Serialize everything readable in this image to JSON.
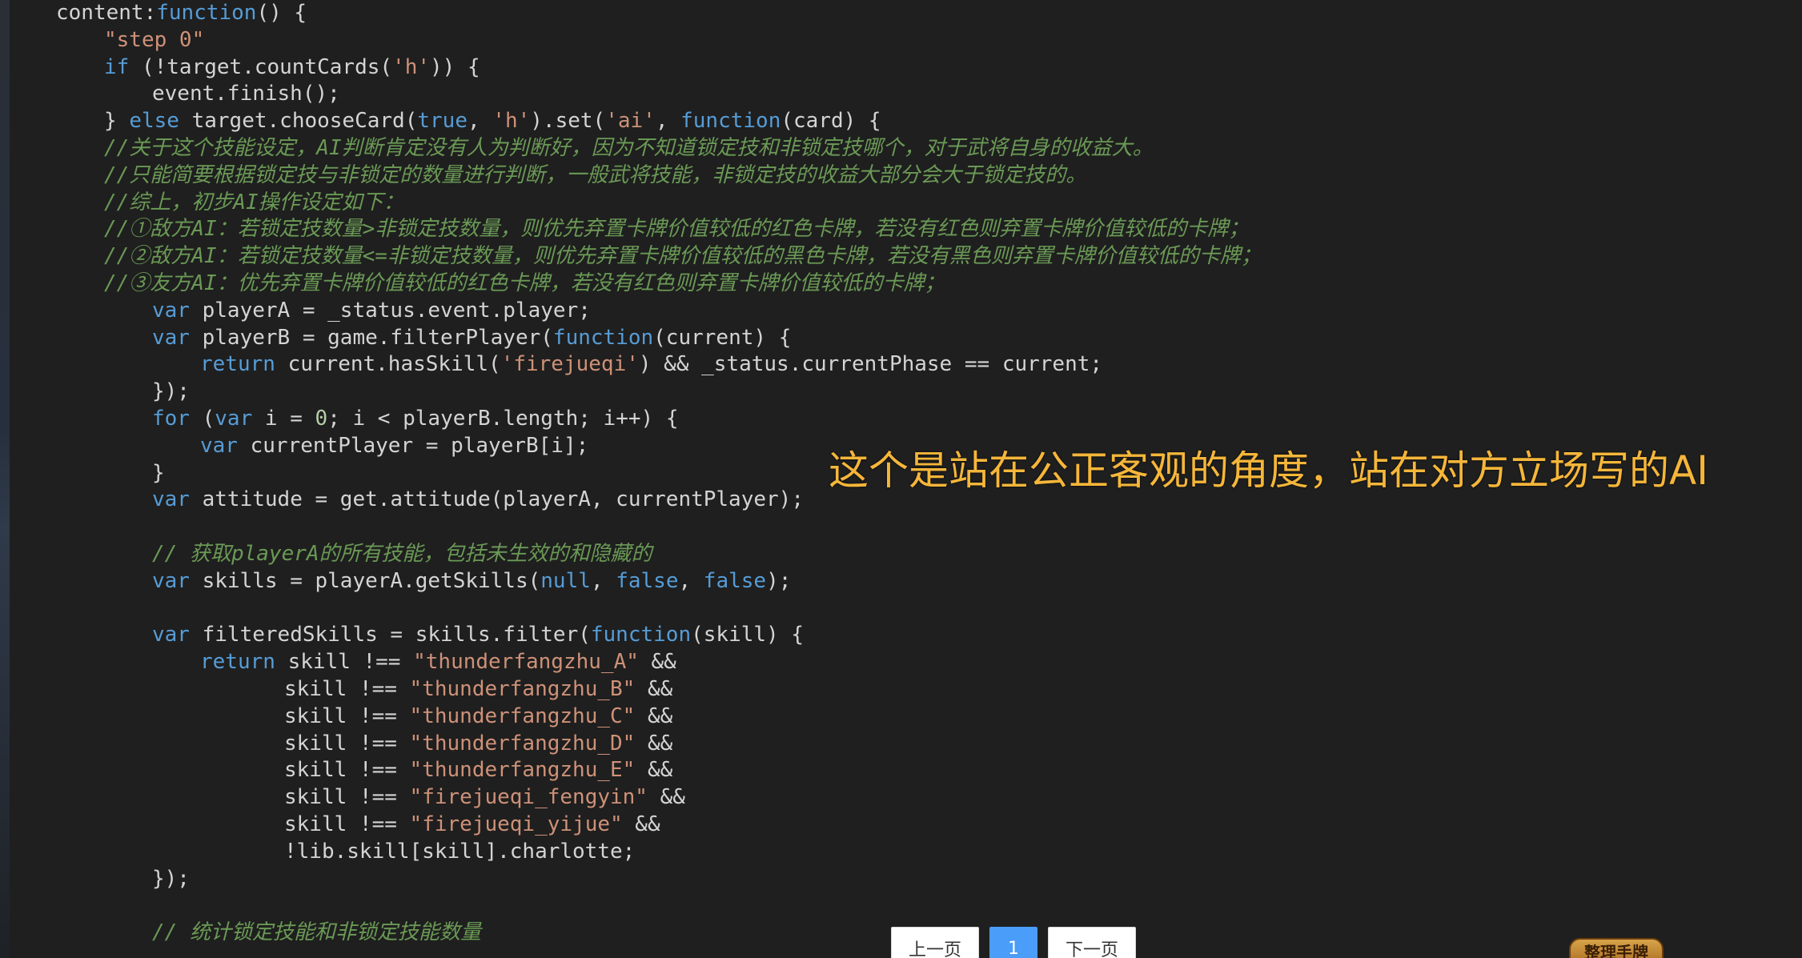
{
  "code_lines": [
    {
      "indent": 0,
      "tokens": [
        {
          "t": "content:"
        },
        {
          "t": "function",
          "c": "kw"
        },
        {
          "t": "() {"
        }
      ]
    },
    {
      "indent": 1,
      "tokens": [
        {
          "t": "\"step 0\"",
          "c": "str"
        }
      ]
    },
    {
      "indent": 1,
      "tokens": [
        {
          "t": "if",
          "c": "kw"
        },
        {
          "t": " (!target.countCards("
        },
        {
          "t": "'h'",
          "c": "str"
        },
        {
          "t": ")) {"
        }
      ]
    },
    {
      "indent": 2,
      "tokens": [
        {
          "t": "event.finish();"
        }
      ]
    },
    {
      "indent": 1,
      "tokens": [
        {
          "t": "} "
        },
        {
          "t": "else",
          "c": "kw"
        },
        {
          "t": " target.chooseCard("
        },
        {
          "t": "true",
          "c": "kw"
        },
        {
          "t": ", "
        },
        {
          "t": "'h'",
          "c": "str"
        },
        {
          "t": ").set("
        },
        {
          "t": "'ai'",
          "c": "str"
        },
        {
          "t": ", "
        },
        {
          "t": "function",
          "c": "kw"
        },
        {
          "t": "(card) {"
        }
      ]
    },
    {
      "indent": 1,
      "tokens": [
        {
          "t": "//关于这个技能设定，AI判断肯定没有人为判断好，因为不知道锁定技和非锁定技哪个，对于武将自身的收益大。",
          "c": "cm"
        }
      ]
    },
    {
      "indent": 1,
      "tokens": [
        {
          "t": "//只能简要根据锁定技与非锁定的数量进行判断，一般武将技能，非锁定技的收益大部分会大于锁定技的。",
          "c": "cm"
        }
      ]
    },
    {
      "indent": 1,
      "tokens": [
        {
          "t": "//综上，初步AI操作设定如下：",
          "c": "cm"
        }
      ]
    },
    {
      "indent": 1,
      "tokens": [
        {
          "t": "//①敌方AI：若锁定技数量>非锁定技数量，则优先弃置卡牌价值较低的红色卡牌，若没有红色则弃置卡牌价值较低的卡牌；",
          "c": "cm"
        }
      ]
    },
    {
      "indent": 1,
      "tokens": [
        {
          "t": "//②敌方AI：若锁定技数量<=非锁定技数量，则优先弃置卡牌价值较低的黑色卡牌，若没有黑色则弃置卡牌价值较低的卡牌；",
          "c": "cm"
        }
      ]
    },
    {
      "indent": 1,
      "tokens": [
        {
          "t": "//③友方AI：优先弃置卡牌价值较低的红色卡牌，若没有红色则弃置卡牌价值较低的卡牌；",
          "c": "cm"
        }
      ]
    },
    {
      "indent": 2,
      "tokens": [
        {
          "t": "var",
          "c": "kw"
        },
        {
          "t": " playerA = _status.event.player;"
        }
      ]
    },
    {
      "indent": 2,
      "tokens": [
        {
          "t": "var",
          "c": "kw"
        },
        {
          "t": " playerB = game.filterPlayer("
        },
        {
          "t": "function",
          "c": "kw"
        },
        {
          "t": "(current) {"
        }
      ]
    },
    {
      "indent": 3,
      "tokens": [
        {
          "t": "return",
          "c": "kw"
        },
        {
          "t": " current.hasSkill("
        },
        {
          "t": "'firejueqi'",
          "c": "str"
        },
        {
          "t": ") && _status.currentPhase == current;"
        }
      ]
    },
    {
      "indent": 2,
      "tokens": [
        {
          "t": "});"
        }
      ]
    },
    {
      "indent": 2,
      "tokens": [
        {
          "t": "for",
          "c": "kw"
        },
        {
          "t": " ("
        },
        {
          "t": "var",
          "c": "kw"
        },
        {
          "t": " i = "
        },
        {
          "t": "0",
          "c": "num"
        },
        {
          "t": "; i < playerB.length; i++) {"
        }
      ]
    },
    {
      "indent": 3,
      "tokens": [
        {
          "t": "var",
          "c": "kw"
        },
        {
          "t": " currentPlayer = playerB[i];"
        }
      ]
    },
    {
      "indent": 2,
      "tokens": [
        {
          "t": "}"
        }
      ]
    },
    {
      "indent": 2,
      "tokens": [
        {
          "t": "var",
          "c": "kw"
        },
        {
          "t": " attitude = get.attitude(playerA, currentPlayer);"
        }
      ]
    },
    {
      "indent": 0,
      "tokens": []
    },
    {
      "indent": 2,
      "tokens": [
        {
          "t": "// 获取playerA的所有技能，包括未生效的和隐藏的",
          "c": "cm"
        }
      ]
    },
    {
      "indent": 2,
      "tokens": [
        {
          "t": "var",
          "c": "kw"
        },
        {
          "t": " skills = playerA.getSkills("
        },
        {
          "t": "null",
          "c": "kw"
        },
        {
          "t": ", "
        },
        {
          "t": "false",
          "c": "kw"
        },
        {
          "t": ", "
        },
        {
          "t": "false",
          "c": "kw"
        },
        {
          "t": ");"
        }
      ]
    },
    {
      "indent": 0,
      "tokens": []
    },
    {
      "indent": 2,
      "tokens": [
        {
          "t": "var",
          "c": "kw"
        },
        {
          "t": " filteredSkills = skills.filter("
        },
        {
          "t": "function",
          "c": "kw"
        },
        {
          "t": "(skill) {"
        }
      ]
    },
    {
      "indent": 3,
      "tokens": [
        {
          "t": "return",
          "c": "kw"
        },
        {
          "t": " skill !== "
        },
        {
          "t": "\"thunderfangzhu_A\"",
          "c": "str"
        },
        {
          "t": " &&"
        }
      ]
    },
    {
      "indent": 4,
      "tokens": [
        {
          "t": "skill !== "
        },
        {
          "t": "\"thunderfangzhu_B\"",
          "c": "str"
        },
        {
          "t": " &&"
        }
      ]
    },
    {
      "indent": 4,
      "tokens": [
        {
          "t": "skill !== "
        },
        {
          "t": "\"thunderfangzhu_C\"",
          "c": "str"
        },
        {
          "t": " &&"
        }
      ]
    },
    {
      "indent": 4,
      "tokens": [
        {
          "t": "skill !== "
        },
        {
          "t": "\"thunderfangzhu_D\"",
          "c": "str"
        },
        {
          "t": " &&"
        }
      ]
    },
    {
      "indent": 4,
      "tokens": [
        {
          "t": "skill !== "
        },
        {
          "t": "\"thunderfangzhu_E\"",
          "c": "str"
        },
        {
          "t": " &&"
        }
      ]
    },
    {
      "indent": 4,
      "tokens": [
        {
          "t": "skill !== "
        },
        {
          "t": "\"firejueqi_fengyin\"",
          "c": "str"
        },
        {
          "t": " &&"
        }
      ]
    },
    {
      "indent": 4,
      "tokens": [
        {
          "t": "skill !== "
        },
        {
          "t": "\"firejueqi_yijue\"",
          "c": "str"
        },
        {
          "t": " &&"
        }
      ]
    },
    {
      "indent": 4,
      "tokens": [
        {
          "t": "!lib.skill[skill].charlotte;"
        }
      ]
    },
    {
      "indent": 2,
      "tokens": [
        {
          "t": "});"
        }
      ]
    },
    {
      "indent": 0,
      "tokens": []
    },
    {
      "indent": 2,
      "tokens": [
        {
          "t": "// 统计锁定技能和非锁定技能数量",
          "c": "cm"
        }
      ]
    }
  ],
  "overlay_note": "这个是站在公正客观的角度，站在对方立场写的AI",
  "pagination": {
    "prev_label": "上一页",
    "current_page": "1",
    "next_label": "下一页"
  },
  "badge_label": "整理手牌"
}
